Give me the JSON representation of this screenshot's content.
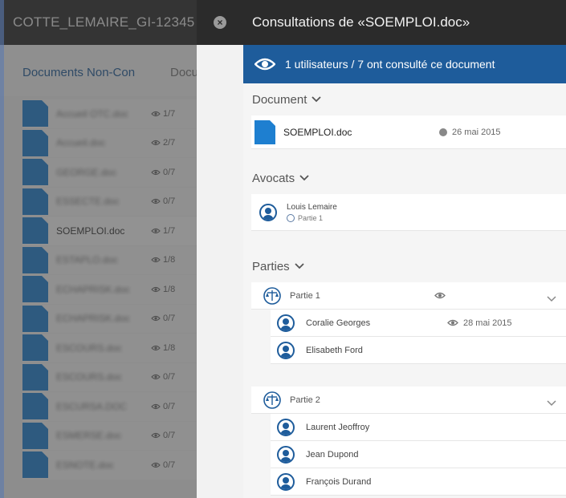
{
  "left": {
    "header_title": "COTTE_LEMAIRE_GI-12345",
    "tabs": [
      "Documents Non-Con",
      "Docu"
    ],
    "documents": [
      {
        "name": "Accueil OTC.doc",
        "count": "1/7",
        "blurred": true
      },
      {
        "name": "Accueil.doc",
        "count": "2/7",
        "blurred": true
      },
      {
        "name": "GEORGE.doc",
        "count": "0/7",
        "blurred": true
      },
      {
        "name": "ESSECTE.doc",
        "count": "0/7",
        "blurred": true
      },
      {
        "name": "SOEMPLOI.doc",
        "count": "1/7",
        "blurred": false
      },
      {
        "name": "ESTAPLO.doc",
        "count": "1/8",
        "blurred": true
      },
      {
        "name": "ECHAPRISK.doc",
        "count": "1/8",
        "blurred": true
      },
      {
        "name": "ECHAPRISK.doc",
        "count": "0/7",
        "blurred": true
      },
      {
        "name": "ESCOURS.doc",
        "count": "1/8",
        "blurred": true
      },
      {
        "name": "ESCOURS.doc",
        "count": "0/7",
        "blurred": true
      },
      {
        "name": "ESCURSA.DOC",
        "count": "0/7",
        "blurred": true
      },
      {
        "name": "ESMERSE.doc",
        "count": "0/7",
        "blurred": true
      },
      {
        "name": "ESNOTE.doc",
        "count": "0/7",
        "blurred": true
      }
    ]
  },
  "panel": {
    "title": "Consultations de «SOEMPLOI.doc»",
    "summary": "1 utilisateurs / 7 ont consulté ce document",
    "document_section": "Document",
    "document": {
      "name": "SOEMPLOI.doc",
      "date": "26 mai 2015"
    },
    "lawyers_section": "Avocats",
    "lawyer": {
      "name": "Louis Lemaire",
      "party": "Partie 1"
    },
    "parties_section": "Parties",
    "parties": [
      {
        "label": "Partie 1",
        "members": [
          {
            "name": "Coralie Georges",
            "date": "28 mai 2015"
          },
          {
            "name": "Elisabeth Ford",
            "date": ""
          }
        ]
      },
      {
        "label": "Partie 2",
        "members": [
          {
            "name": "Laurent Jeoffroy",
            "date": ""
          },
          {
            "name": "Jean Dupond",
            "date": ""
          },
          {
            "name": "François Durand",
            "date": ""
          }
        ]
      }
    ]
  },
  "colors": {
    "accent": "#1e5c9b",
    "header": "#2b2b2b",
    "file_icon": "#1e7fd0"
  },
  "icons": [
    "eye-icon",
    "chevron-down-icon",
    "close-icon",
    "user-icon",
    "scale-icon",
    "clock-icon"
  ]
}
